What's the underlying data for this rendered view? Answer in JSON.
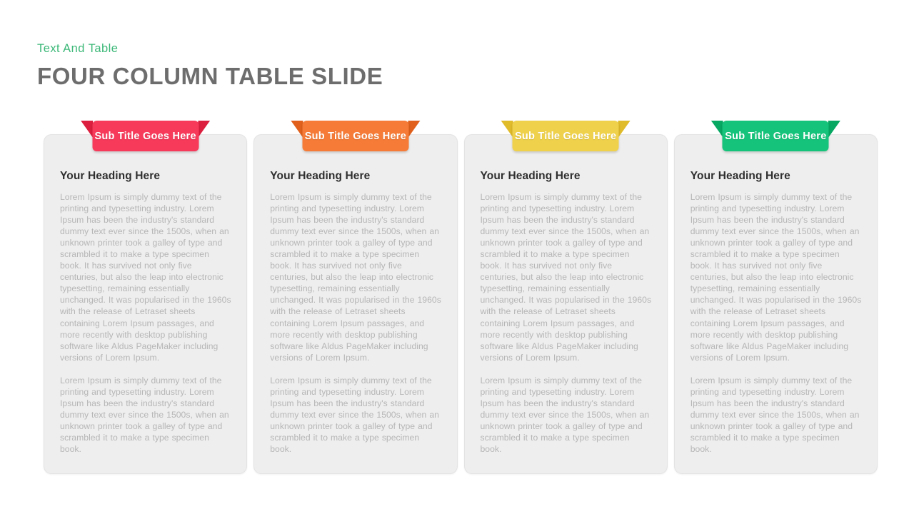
{
  "header": {
    "eyebrow": "Text And  Table",
    "title": "FOUR COLUMN TABLE SLIDE",
    "eyebrow_color": "#3cb878",
    "title_color": "#6d6d6d"
  },
  "canvas": {
    "background": "#ffffff"
  },
  "card_style": {
    "background": "#eeeeee",
    "border_color": "#e3e3e3",
    "heading_color": "#2f2f2f",
    "body_color": "#b6b6b6"
  },
  "columns": [
    {
      "ribbon_label": "Sub Title Goes Here",
      "ribbon_color": "#f7395a",
      "ribbon_tail_color": "#dc1f3f",
      "heading": "Your Heading Here",
      "paragraphs": [
        "Lorem Ipsum is simply dummy text of the printing and typesetting industry. Lorem Ipsum has been the industry's standard dummy text ever  since the 1500s,  when an unknown  printer took a galley of type and  scrambled it to make a type specimen book. It has survived  not only five  centuries, but also the leap into electronic typesetting, remaining essentially unchanged.  It was popularised  in the 1960s with the release of Letraset sheets containing Lorem Ipsum passages, and more recently with desktop publishing software  like Aldus PageMaker including versions  of Lorem Ipsum.",
        "Lorem Ipsum is simply dummy text of the printing and typesetting industry. Lorem Ipsum has been the industry's standard dummy text ever  since the 1500s,  when an unknown  printer took a galley of type and  scrambled it to make a type specimen book."
      ]
    },
    {
      "ribbon_label": "Sub Title Goes Here",
      "ribbon_color": "#f57b36",
      "ribbon_tail_color": "#e0601c",
      "heading": "Your Heading Here",
      "paragraphs": [
        "Lorem Ipsum is simply dummy text of the printing and typesetting industry. Lorem Ipsum has been the industry's standard dummy text ever  since the 1500s,  when an unknown  printer took a galley of type and  scrambled it to make a type specimen book. It has survived  not only five  centuries, but also the leap into electronic typesetting, remaining essentially unchanged.  It was popularised  in the 1960s with the release of Letraset sheets containing Lorem Ipsum passages, and more recently with desktop publishing software  like Aldus PageMaker including versions  of Lorem Ipsum.",
        "Lorem Ipsum is simply dummy text of the printing and typesetting industry. Lorem Ipsum has been the industry's standard dummy text ever  since the 1500s,  when an unknown  printer took a galley of type and  scrambled it to make a type specimen book."
      ]
    },
    {
      "ribbon_label": "Sub Title Goes Here",
      "ribbon_color": "#efd14b",
      "ribbon_tail_color": "#e0bb2a",
      "heading": "Your Heading Here",
      "paragraphs": [
        "Lorem Ipsum is simply dummy text of the printing and typesetting industry. Lorem Ipsum has been the industry's standard dummy text ever  since the 1500s,  when an unknown  printer took a galley of type and  scrambled it to make a type specimen book. It has survived  not only five  centuries, but also the leap into electronic typesetting, remaining essentially unchanged.  It was popularised  in the 1960s with the release of Letraset sheets containing Lorem Ipsum passages, and more recently with desktop publishing software  like Aldus PageMaker including versions  of Lorem Ipsum.",
        "Lorem Ipsum is simply dummy text of the printing and typesetting industry. Lorem Ipsum has been the industry's standard dummy text ever  since the 1500s,  when an unknown  printer took a galley of type and  scrambled it to make a type specimen book."
      ]
    },
    {
      "ribbon_label": "Sub Title Goes Here",
      "ribbon_color": "#15c47a",
      "ribbon_tail_color": "#06a862",
      "heading": "Your Heading Here",
      "paragraphs": [
        "Lorem Ipsum is simply dummy text of the printing and typesetting industry. Lorem Ipsum has been the industry's standard dummy text ever  since the 1500s,  when an unknown  printer took a galley of type and  scrambled it to make a type specimen book. It has survived  not only five  centuries, but also the leap into electronic typesetting, remaining essentially unchanged.  It was popularised  in the 1960s with the release of Letraset sheets containing Lorem Ipsum passages, and more recently with desktop publishing software  like Aldus PageMaker including versions  of Lorem Ipsum.",
        "Lorem Ipsum is simply dummy text of the printing and typesetting industry. Lorem Ipsum has been the industry's standard dummy text ever  since the 1500s,  when an unknown  printer took a galley of type and  scrambled it to make a type specimen book."
      ]
    }
  ]
}
